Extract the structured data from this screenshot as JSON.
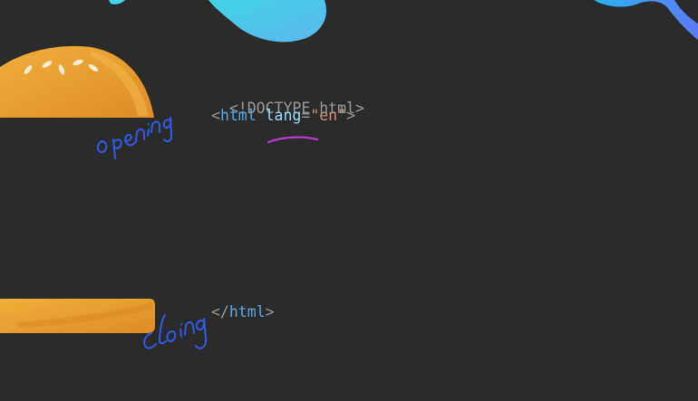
{
  "code": {
    "line1": "<!DOCTYPE html>",
    "line2": {
      "open": "<",
      "tag": "html",
      "space": " ",
      "attr": "lang",
      "eq": "=",
      "value": "\"en\"",
      "close": ">"
    },
    "closing": {
      "open": "</",
      "tag": "html",
      "close": ">"
    }
  },
  "annotations": {
    "opening_word": "opening",
    "closing_word": "closing"
  },
  "colors": {
    "background": "#2b2b2b",
    "bun": "#e39a2c",
    "bun_shade": "#f0ad3d",
    "handwriting": "#2f5be6",
    "underline": "#b43cc8",
    "tag": "#5aa9e6",
    "attr": "#9cdcfe",
    "string": "#ce9178"
  }
}
